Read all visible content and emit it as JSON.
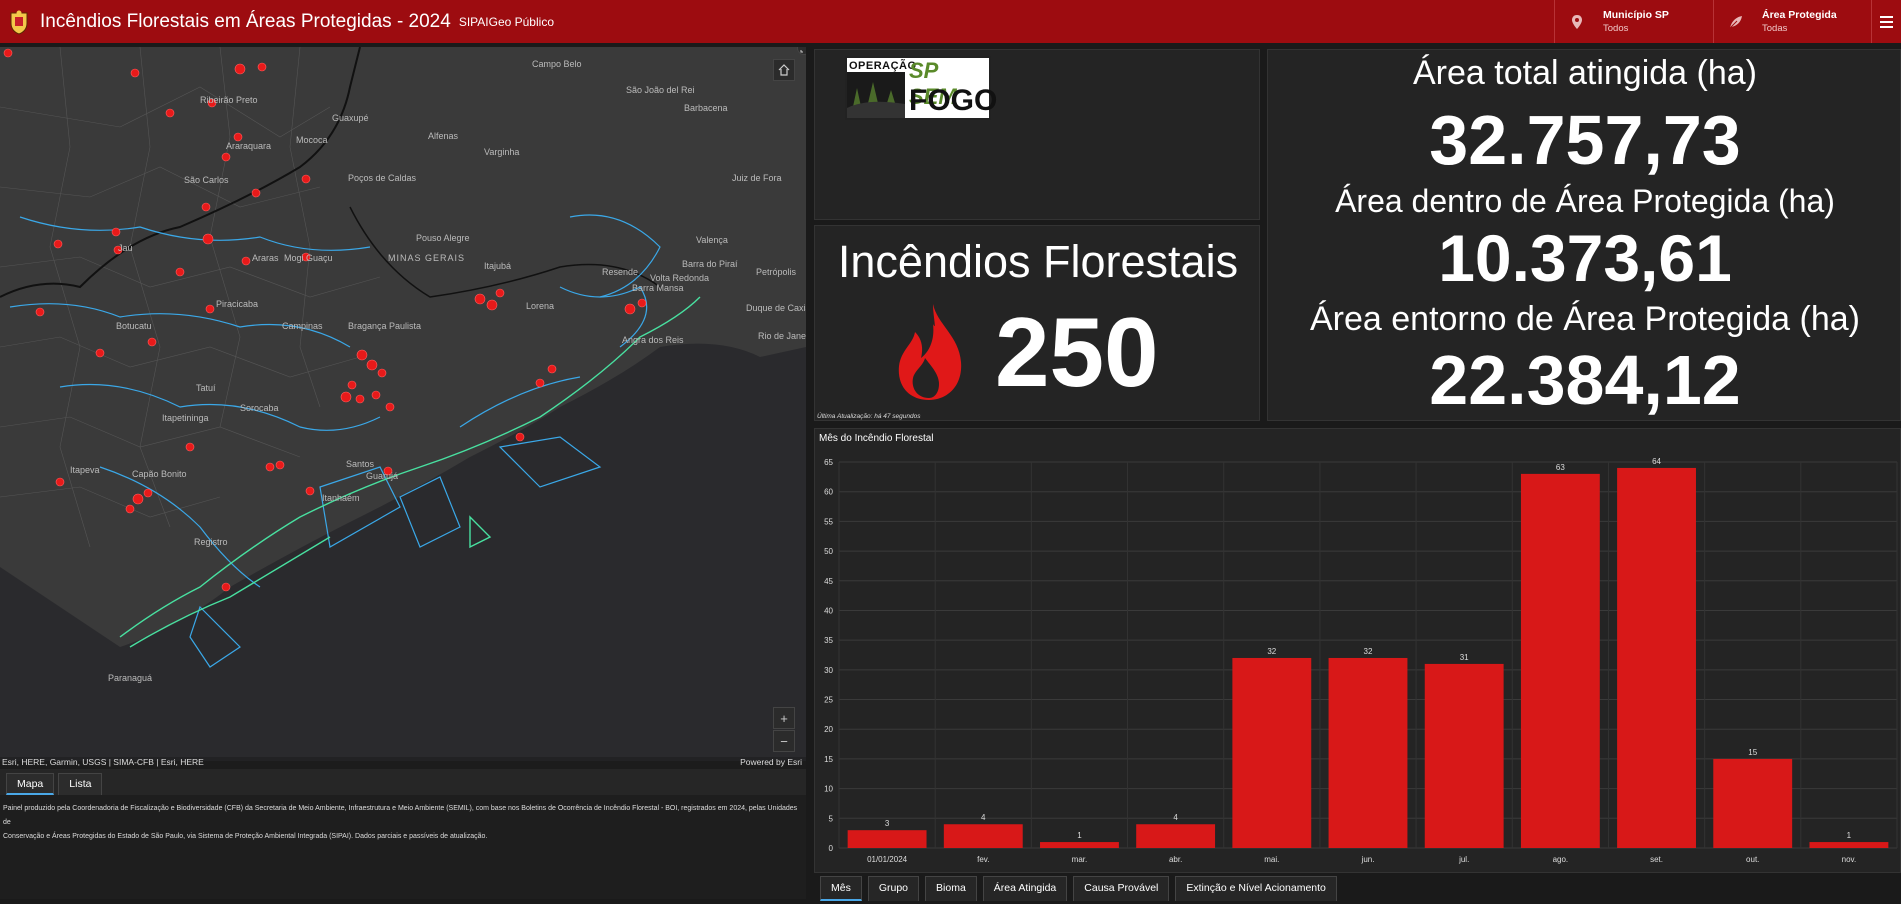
{
  "header": {
    "title": "Incêndios Florestais em Áreas Protegidas - 2024",
    "subtitle": "SIPAIGeo Público",
    "filters": [
      {
        "name": "Município SP",
        "value": "Todos",
        "icon": "location-pin-icon"
      },
      {
        "name": "Área Protegida",
        "value": "Todas",
        "icon": "leaf-icon"
      }
    ]
  },
  "colors": {
    "header": "#9d0c10",
    "bar": "#d81818",
    "fire_marker": "#e81a1a",
    "boundary_blue": "#3aa8e8",
    "boundary_green": "#48e0a0"
  },
  "map": {
    "attribution": "Esri, HERE, Garmin, USGS | SIMA-CFB | Esri, HERE",
    "powered_by": "Powered by Esri",
    "places": [
      "Campo Belo",
      "São João del Rei",
      "Barbacena",
      "Alfenas",
      "Varginha",
      "Juiz de Fora",
      "Poços de Caldas",
      "Pouso Alegre",
      "MINAS GERAIS",
      "Itajubá",
      "Resende",
      "Barra Mansa",
      "Volta Redonda",
      "Barra do Piraí",
      "Valença",
      "Petrópolis",
      "Duque de Caxias",
      "Rio de Janeiro",
      "Angra dos Reis",
      "Campinas",
      "Bragança Paulista",
      "Botucatu",
      "Jaú",
      "Piracicaba",
      "Tatuí",
      "Itapetininga",
      "Itapeva",
      "Capão Bonito",
      "Registro",
      "Guarujá",
      "Santos",
      "Paranaguá",
      "Lorena",
      "São Carlos",
      "Araraquara",
      "Ribeirão Preto",
      "Mococa",
      "Araras",
      "Mogi Guaçu",
      "Guaxupé",
      "Sorocaba",
      "Itanhaém"
    ],
    "tabs": [
      "Mapa",
      "Lista"
    ],
    "footer_line1": "Painel produzido pela Coordenadoria de Fiscalização e Biodiversidade (CFB) da Secretaria de Meio Ambiente, Infraestrutura e Meio Ambiente (SEMIL), com base nos Boletins de Ocorrência de Incêndio Florestal - BOI, registrados em 2024, pelas Unidades de",
    "footer_line2": "Conservação e Áreas Protegidas do Estado de São Paulo, via Sistema de Proteção Ambiental Integrada (SIPAI). Dados parciais e passíveis de atualização."
  },
  "logo": {
    "line1": "OPERAÇÃO",
    "line2": "SP SEM",
    "line3": "FOGO"
  },
  "fires": {
    "title": "Incêndios Florestais",
    "count": "250",
    "last_update": "Última Atualização: há 47 segundos"
  },
  "areas": {
    "total_label": "Área total atingida (ha)",
    "total_value": "32.757,73",
    "inside_label": "Área dentro de Área Protegida (ha)",
    "inside_value": "10.373,61",
    "around_label": "Área entorno de Área Protegida (ha)",
    "around_value": "22.384,12"
  },
  "chart_data": {
    "type": "bar",
    "title": "Mês do  Incêndio Florestal",
    "categories": [
      "01/01/2024",
      "fev.",
      "mar.",
      "abr.",
      "mai.",
      "jun.",
      "jul.",
      "ago.",
      "set.",
      "out.",
      "nov."
    ],
    "values": [
      3,
      4,
      1,
      4,
      32,
      32,
      31,
      63,
      64,
      15,
      1
    ],
    "ylim": [
      0,
      65
    ],
    "yticks": [
      0,
      5,
      10,
      15,
      20,
      25,
      30,
      35,
      40,
      45,
      50,
      55,
      60,
      65
    ],
    "grid": true
  },
  "chart_tabs": [
    "Mês",
    "Grupo",
    "Bioma",
    "Área Atingida",
    "Causa Provável",
    "Extinção e Nível Acionamento"
  ]
}
